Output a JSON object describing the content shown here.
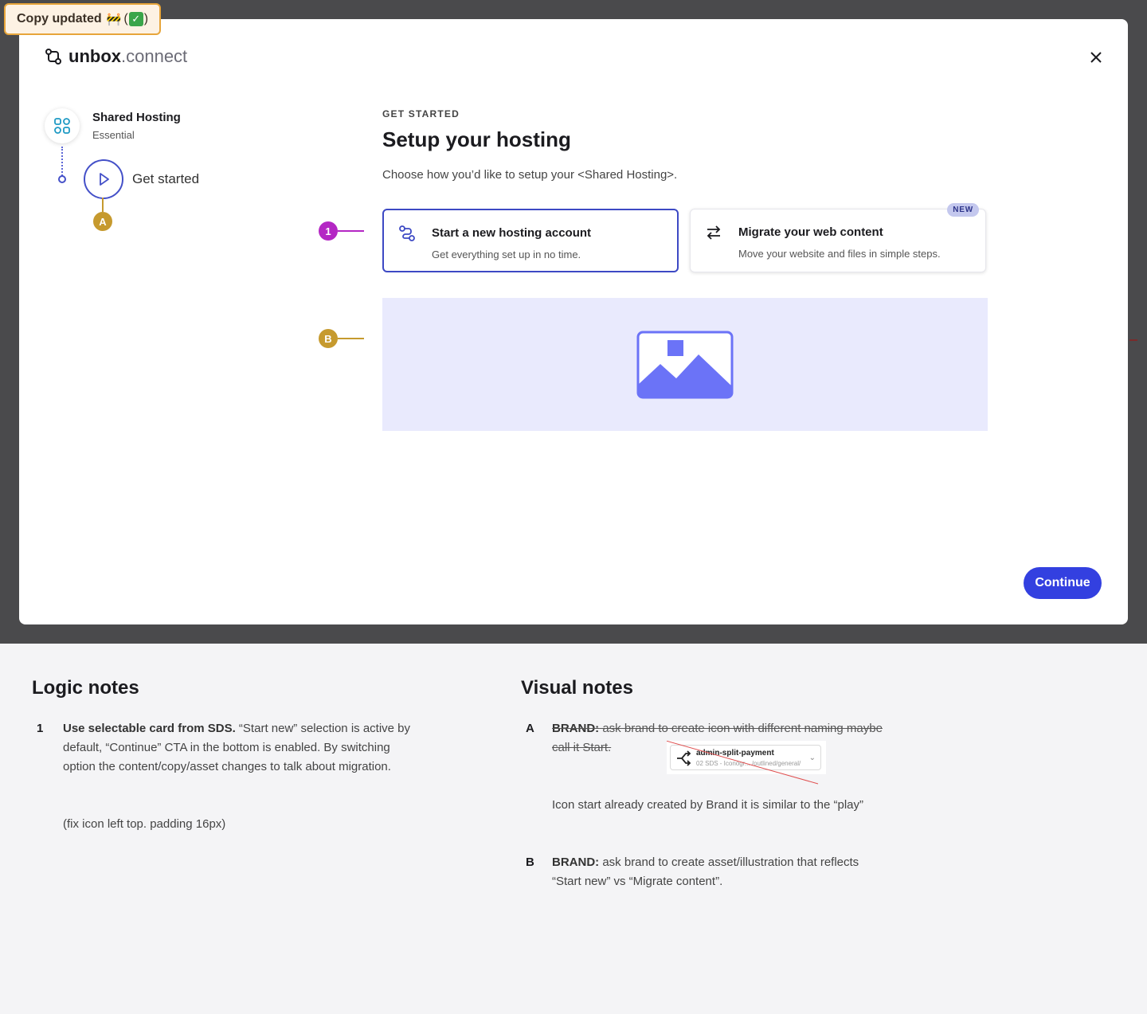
{
  "tag": {
    "label": "Copy updated",
    "emoji": "🚧",
    "paren_open": "(",
    "check": "✓",
    "paren_close": ")"
  },
  "brand": {
    "name_bold": "unbox",
    "name_rest": ".connect"
  },
  "stepper": {
    "product_title": "Shared Hosting",
    "product_sub": "Essential",
    "step_label": "Get started",
    "marker": "A"
  },
  "main": {
    "eyebrow": "GET STARTED",
    "title": "Setup your hosting",
    "description": "Choose how you’d like to setup your <Shared Hosting>.",
    "cards": [
      {
        "title": "Start a new hosting account",
        "subtitle": "Get everything set up in no time.",
        "selected": true
      },
      {
        "title": "Migrate your web content",
        "subtitle": "Move your website and files in simple steps.",
        "badge": "NEW",
        "selected": false
      }
    ],
    "callout_1": "1",
    "callout_b": "B"
  },
  "footer": {
    "continue_label": "Continue"
  },
  "notes": {
    "logic": {
      "heading": "Logic notes",
      "items": [
        {
          "num": "1",
          "bold": "Use selectable card from SDS.",
          "text": " “Start new” selection is active by default, “Continue” CTA in the bottom is enabled. By switching option the content/copy/asset changes to talk about migration.",
          "extra": "(fix icon left top. padding 16px)"
        }
      ]
    },
    "visual": {
      "heading": "Visual notes",
      "items": [
        {
          "num": "A",
          "strike_bold": "BRAND:",
          "strike_text": " ask brand to create icon with different naming maybe call it Start.",
          "snippet_title": "admin-split-payment",
          "snippet_sub": "02 SDS - Iconogr... /outlined/general/",
          "text": "Icon start already created by Brand it is similar to the “play”"
        },
        {
          "num": "B",
          "bold": "BRAND:",
          "text": " ask brand to create asset/illustration that reflects “Start new” vs “Migrate content”."
        }
      ]
    }
  },
  "colors": {
    "primary": "#3340e0",
    "selected_border": "#3d49c4",
    "callout_1": "#b427c4",
    "callout_ab": "#c69a2e",
    "asset_bg": "#e9eafd",
    "asset_icon": "#6b73f7"
  }
}
